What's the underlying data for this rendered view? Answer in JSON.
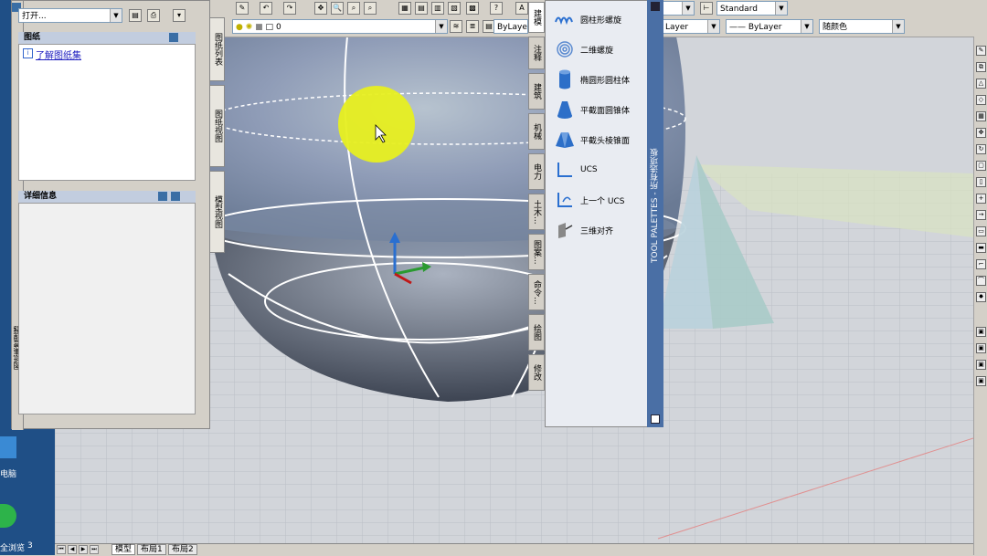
{
  "toolbar": {
    "layer_name": "0",
    "text_style": "Standard",
    "color_layer1": "ByLayer",
    "color_layer2": "ByLayer",
    "linetype": "ByLayer",
    "color_bylayer": "随颜色",
    "layer_combo": "Layer"
  },
  "sheet_manager": {
    "open_combo": "打开...",
    "panel1_title": "图纸",
    "panel1_link": "了解图纸集",
    "panel2_title": "详细信息",
    "tabs": [
      "图纸列表",
      "图纸视图",
      "模型视图"
    ],
    "side_label": "图纸集管理器"
  },
  "tool_palette": {
    "title": "TOOL PALETTES - 所有选项板",
    "tabs": [
      "建模",
      "注释",
      "建筑",
      "机械",
      "电力",
      "土木...",
      "图案...",
      "命令...",
      "绘图",
      "修改"
    ],
    "items": [
      {
        "label": "圆柱形螺旋",
        "icon": "helix-icon"
      },
      {
        "label": "二维螺旋",
        "icon": "spiral-icon"
      },
      {
        "label": "椭圆形圆柱体",
        "icon": "cylinder-icon"
      },
      {
        "label": "平截面圆锥体",
        "icon": "cone-icon"
      },
      {
        "label": "平截头棱锥面",
        "icon": "pyramid-icon"
      },
      {
        "label": "UCS",
        "icon": "ucs-icon"
      },
      {
        "label": "上一个 UCS",
        "icon": "previous-ucs-icon"
      },
      {
        "label": "三维对齐",
        "icon": "align3d-icon"
      }
    ]
  },
  "layout_tabs": [
    "模型",
    "布局1",
    "布局2"
  ],
  "desktop": {
    "label1": "电脑",
    "label2": "全浏览",
    "label3": "3"
  }
}
